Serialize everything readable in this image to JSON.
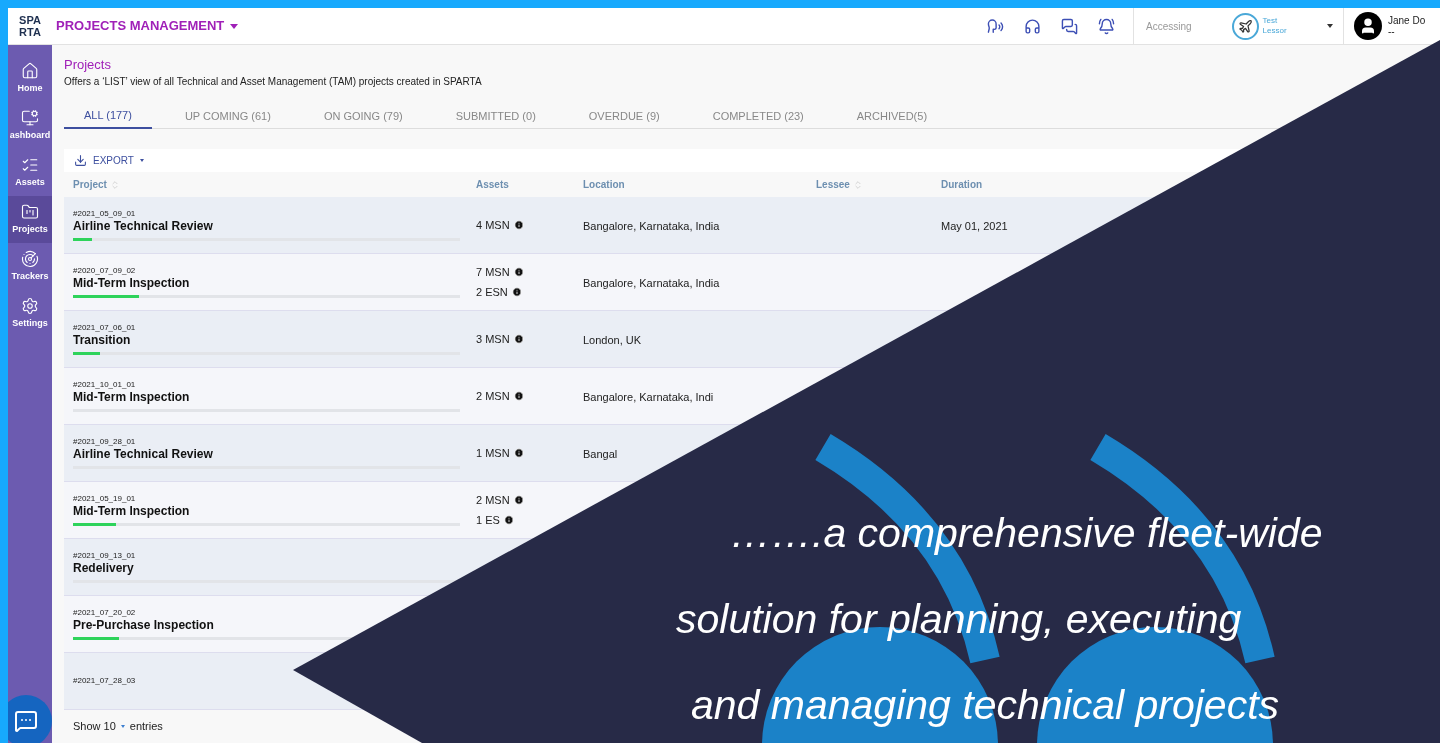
{
  "header": {
    "logo": "SPA\nRTA",
    "module": "PROJECTS MANAGEMENT",
    "accessing_label": "Accessing",
    "account": {
      "line_1": "Test",
      "line_2": "Lessor"
    },
    "user": {
      "name": "Jane Do",
      "role": "--"
    }
  },
  "sidebar": {
    "items": [
      {
        "kind": "home",
        "label": "Home",
        "selected": false
      },
      {
        "kind": "dashboard",
        "label": "ashboard",
        "selected": false
      },
      {
        "kind": "assets",
        "label": "Assets",
        "selected": false
      },
      {
        "kind": "projects",
        "label": "Projects",
        "selected": true
      },
      {
        "kind": "trackers",
        "label": "Trackers",
        "selected": false
      },
      {
        "kind": "settings",
        "label": "Settings",
        "selected": false
      }
    ]
  },
  "page": {
    "title": "Projects",
    "subtitle": "Offers a ‘LIST’ view of all Technical and Asset Management (TAM) projects created in SPARTA"
  },
  "tabs": [
    {
      "label": "ALL (177)",
      "selected": true
    },
    {
      "label": "UP COMING (61)",
      "selected": false
    },
    {
      "label": "ON GOING (79)",
      "selected": false
    },
    {
      "label": "SUBMITTED (0)",
      "selected": false
    },
    {
      "label": "OVERDUE (9)",
      "selected": false
    },
    {
      "label": "COMPLETED (23)",
      "selected": false
    },
    {
      "label": "ARCHIVED(5)",
      "selected": false
    }
  ],
  "export": "EXPORT",
  "table": {
    "columns": [
      {
        "label": "Project",
        "sortable": true
      },
      {
        "label": "Assets",
        "sortable": false
      },
      {
        "label": "Location",
        "sortable": false
      },
      {
        "label": "Lessee",
        "sortable": true
      },
      {
        "label": "Duration",
        "sortable": false
      }
    ],
    "rows": [
      {
        "id": "#2021_05_09_01",
        "name": "Airline Technical Review",
        "level": 0.05,
        "assets": [
          "4 MSN"
        ],
        "location": "Bangalore, Karnataka, India",
        "duration": "May 01, 2021"
      },
      {
        "id": "#2020_07_09_02",
        "name": "Mid-Term Inspection",
        "level": 0.17,
        "assets": [
          "7 MSN",
          "2 ESN"
        ],
        "location": "Bangalore, Karnataka, India"
      },
      {
        "id": "#2021_07_06_01",
        "name": "Transition",
        "level": 0.07,
        "assets": [
          "3 MSN"
        ],
        "location": "London, UK"
      },
      {
        "id": "#2021_10_01_01",
        "name": "Mid-Term Inspection",
        "level": 0,
        "assets": [
          "2 MSN"
        ],
        "location": "Bangalore, Karnataka, Indi"
      },
      {
        "id": "#2021_09_28_01",
        "name": "Airline Technical Review",
        "level": 0,
        "assets": [
          "1 MSN"
        ],
        "location": "Bangal"
      },
      {
        "id": "#2021_05_19_01",
        "name": "Mid-Term Inspection",
        "level": 0.11,
        "assets": [
          "2 MSN",
          "1 ES"
        ]
      },
      {
        "id": "#2021_09_13_01",
        "name": "Redelivery",
        "level": 0
      },
      {
        "id": "#2021_07_20_02",
        "name": "Pre-Purchase Inspection",
        "level": 0.12
      },
      {
        "id": "#2021_07_28_03"
      }
    ]
  },
  "footer": {
    "show": "Show 10",
    "entries": "entries"
  },
  "quote": {
    "lines": [
      "…….a comprehensive fleet-wide",
      "solution for planning, executing",
      "and managing technical projects"
    ]
  }
}
